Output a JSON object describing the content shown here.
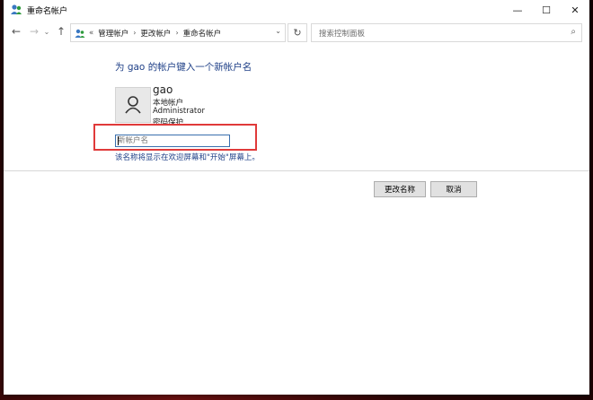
{
  "window": {
    "title": "重命名帐户",
    "controls": [
      "—",
      "☐",
      "✕"
    ]
  },
  "nav": {
    "back_glyph": "←",
    "forward_glyph": "→",
    "dropdown_glyph": "⌄",
    "up_glyph": "↑",
    "address": {
      "overflow": "«",
      "breadcrumbs": [
        "管理帐户",
        "更改帐户",
        "重命名帐户"
      ],
      "separator": "›",
      "chevron": "⌄"
    },
    "refresh_glyph": "↻",
    "search": {
      "placeholder": "搜索控制面板",
      "icon": "⌕"
    }
  },
  "main": {
    "heading": "为 gao 的帐户键入一个新帐户名",
    "user": {
      "name": "gao",
      "type": "本地帐户",
      "group": "Administrator",
      "password": "密码保护"
    },
    "new_name_input": {
      "placeholder": "新帐户名",
      "value": ""
    },
    "hint": "该名称将显示在欢迎屏幕和\"开始\"屏幕上。"
  },
  "actions": {
    "rename_label": "更改名称",
    "cancel_label": "取消"
  },
  "colors": {
    "accent_text": "#1e3f87",
    "highlight_box": "#e03a3a",
    "input_border": "#3a6fae"
  }
}
